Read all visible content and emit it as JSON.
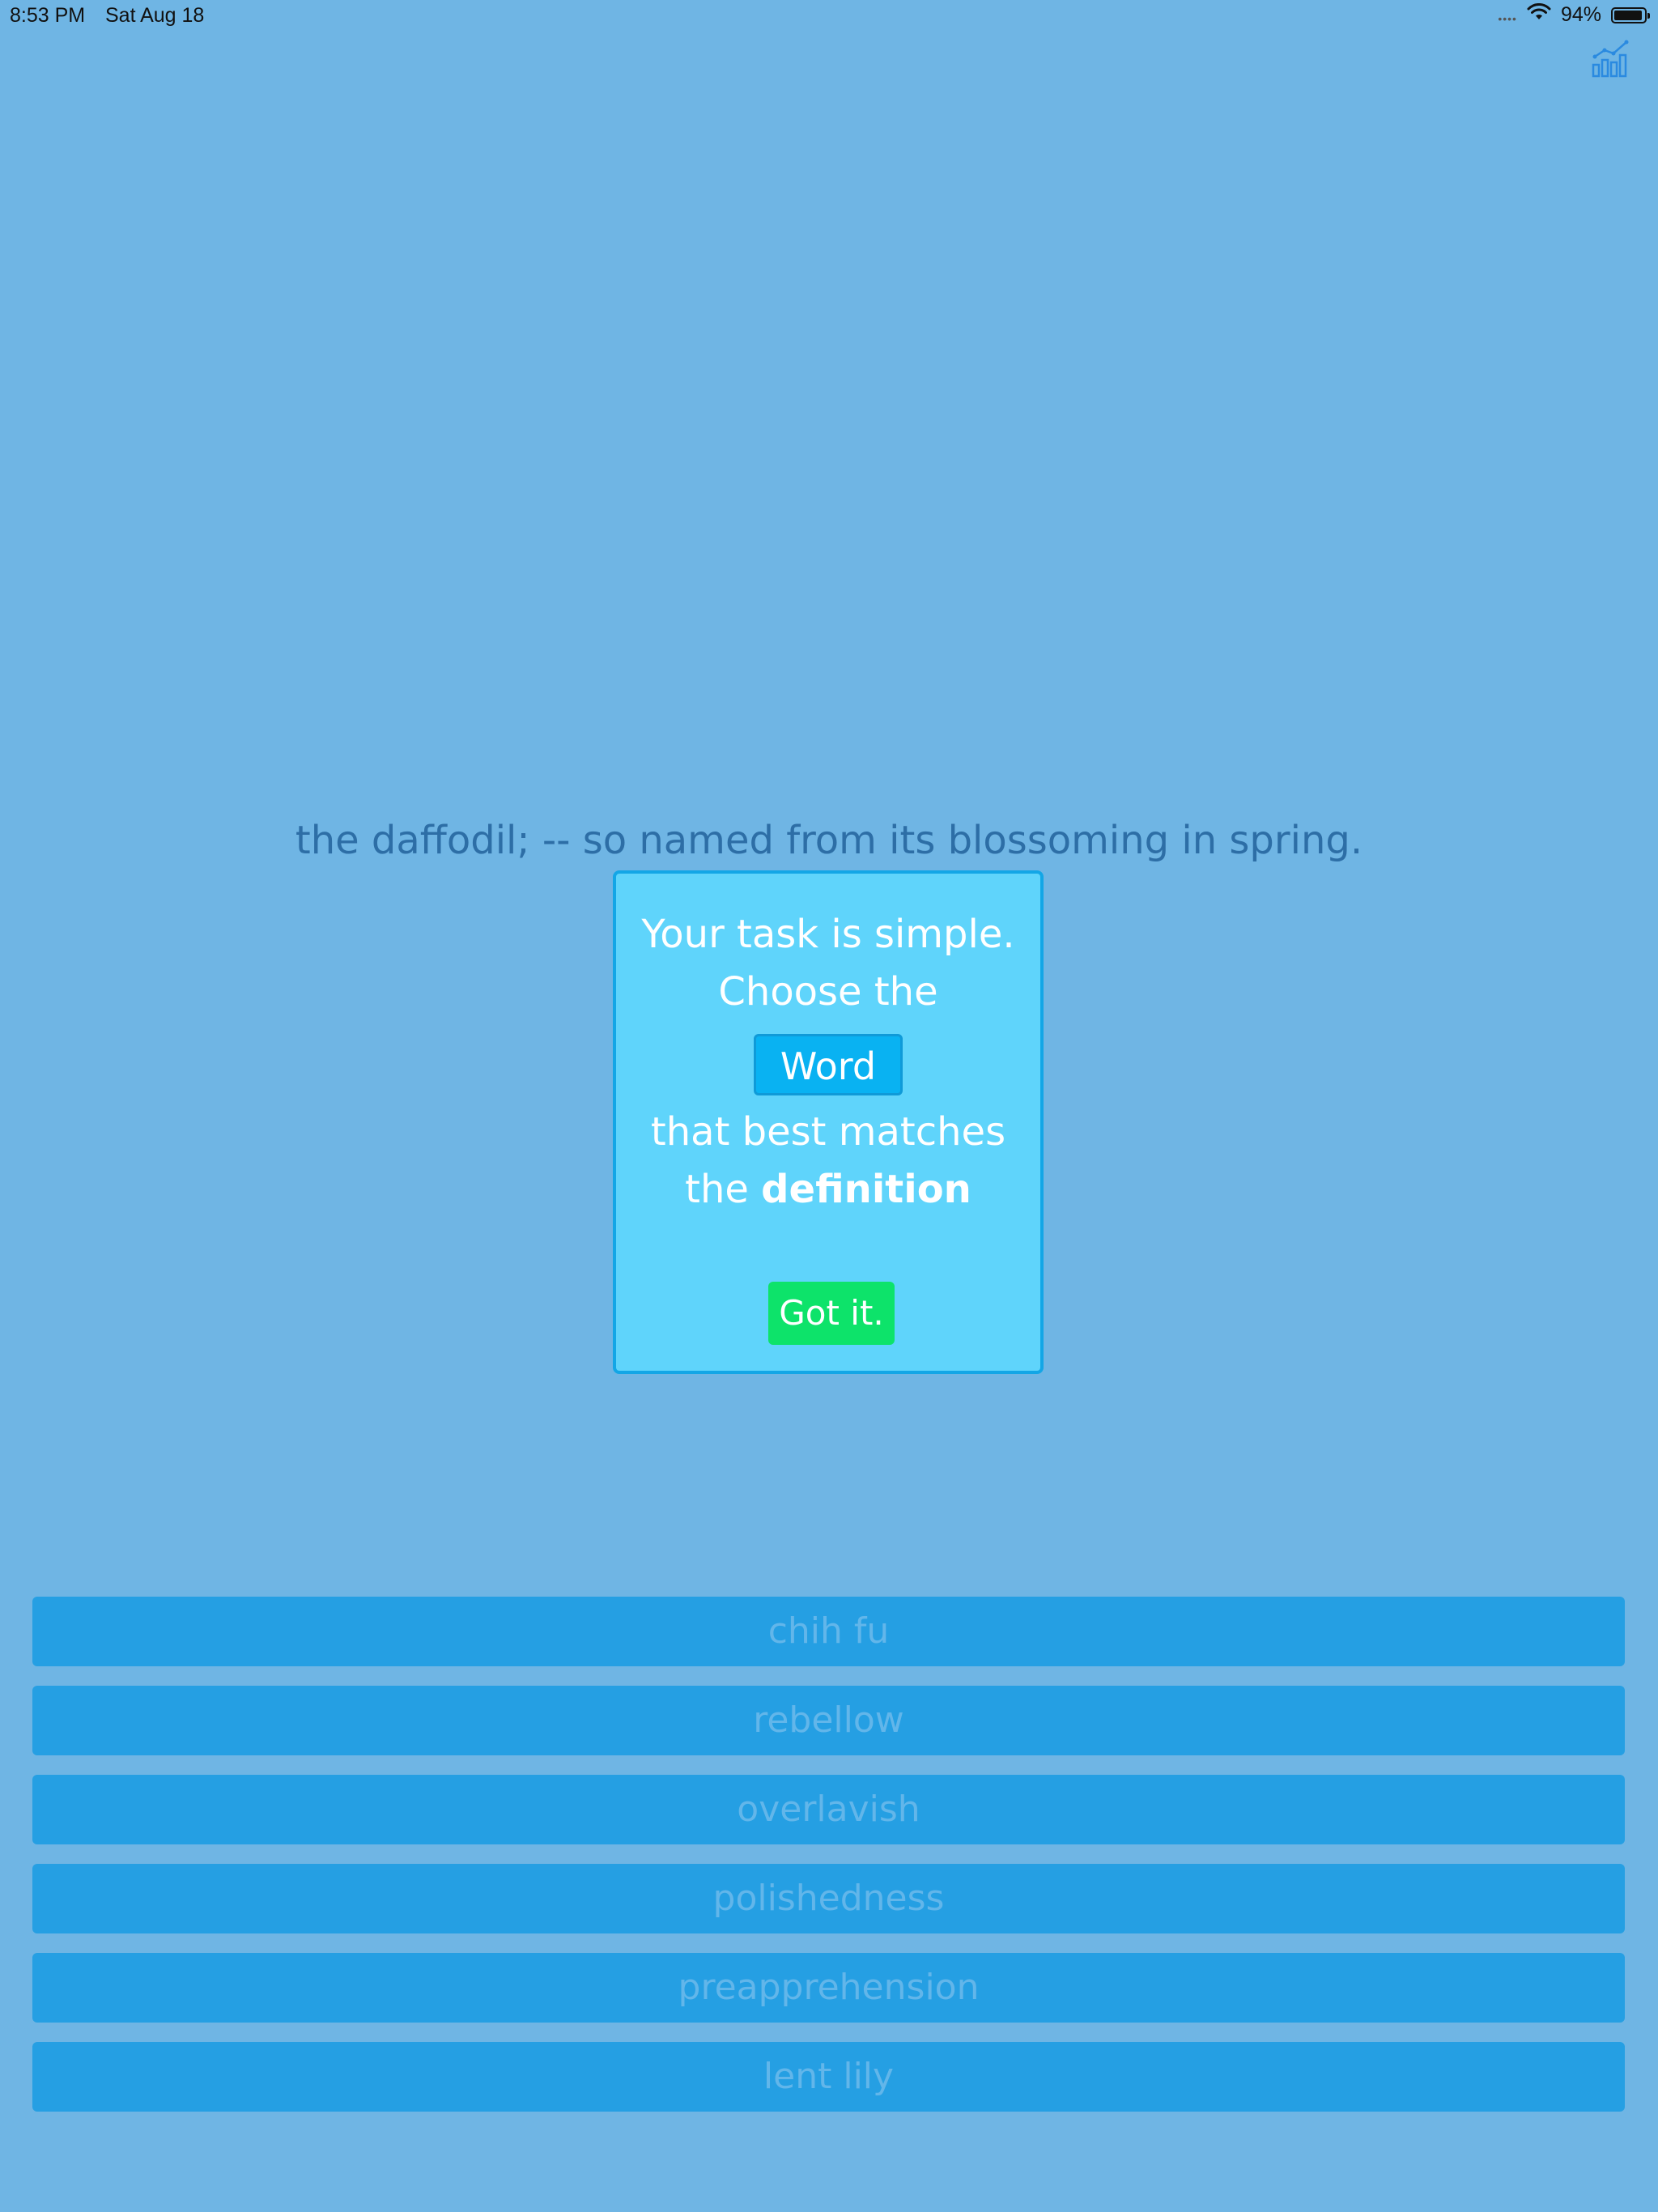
{
  "status_bar": {
    "time": "8:53 PM",
    "date": "Sat Aug 18",
    "battery_percent": "94%",
    "battery_level": 0.94
  },
  "header": {
    "stats_icon": "bar-line-chart-icon"
  },
  "definition": {
    "text": "the daffodil; -- so named from its blossoming in spring."
  },
  "modal": {
    "line1": "Your task is simple.",
    "line2": "Choose the",
    "word_chip": "Word",
    "line3": "that best matches",
    "line4_prefix": "the ",
    "line4_bold": "definition",
    "button_label": "Got it."
  },
  "answers": [
    {
      "label": "chih fu"
    },
    {
      "label": "rebellow"
    },
    {
      "label": "overlavish"
    },
    {
      "label": "polishedness"
    },
    {
      "label": "preapprehension"
    },
    {
      "label": "lent lily"
    }
  ],
  "colors": {
    "background": "#6fb5e4",
    "modal_bg": "#5fd4fb",
    "modal_border": "#13a6e6",
    "got_it": "#0de36a",
    "answer_bg": "#259fe3",
    "answer_text": "#62b6ea",
    "definition_text": "#2d6ea6"
  }
}
